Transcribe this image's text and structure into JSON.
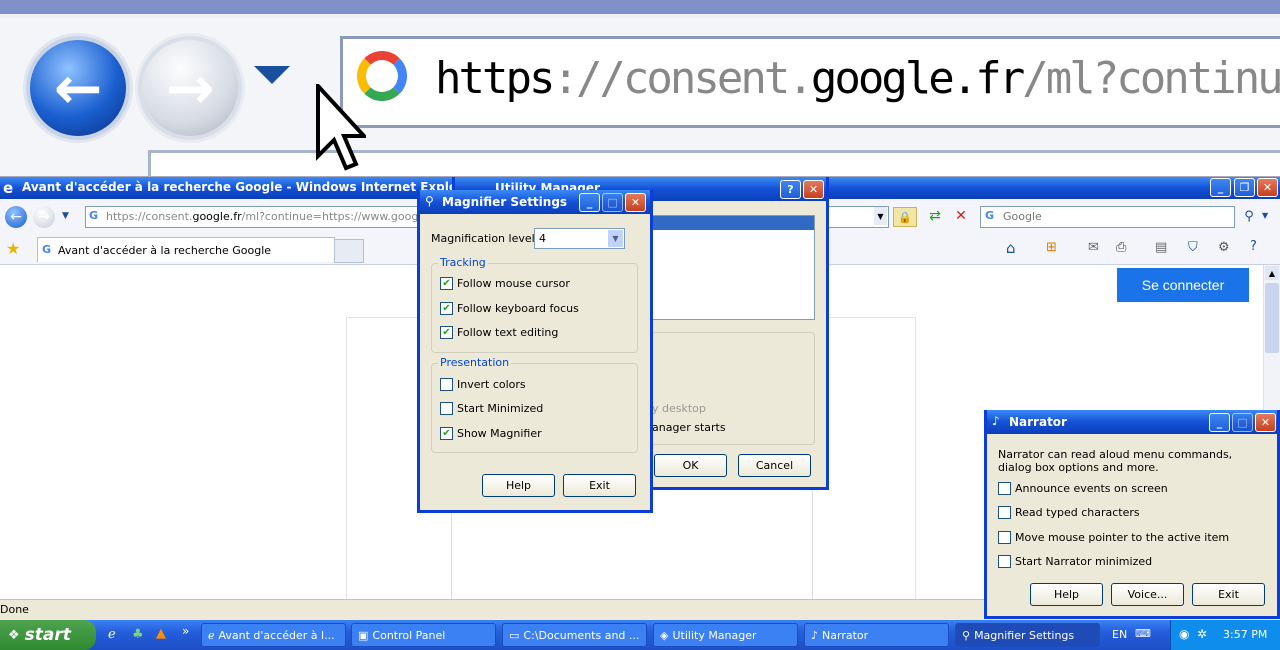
{
  "magnifier_pane": {
    "url_host_prefix": "https",
    "url_sep": "://consent.",
    "url_domain": "google.fr",
    "url_rest": "/ml?continue=http"
  },
  "ie": {
    "title": "Avant d'accéder à la recherche Google - Windows Internet Explorer",
    "address_prefix": "https://consent.",
    "address_domain": "google.fr",
    "address_rest": "/ml?continue=https://www.google.fr/?",
    "search_placeholder": "Google",
    "tab_label": "Avant d'accéder à la recherche Google",
    "sign_in": "Se connecter",
    "status": "Done"
  },
  "utility_manager": {
    "title": "Utility Manager",
    "ok": "OK",
    "cancel": "Cancel",
    "option_partial_1": "y desktop",
    "option_partial_2": "anager starts"
  },
  "magnifier": {
    "title": "Magnifier Settings",
    "level_label": "Magnification level:",
    "level_value": "4",
    "tracking_label": "Tracking",
    "tracking": [
      {
        "label": "Follow mouse cursor",
        "checked": true
      },
      {
        "label": "Follow keyboard focus",
        "checked": true
      },
      {
        "label": "Follow text editing",
        "checked": true
      }
    ],
    "presentation_label": "Presentation",
    "presentation": [
      {
        "label": "Invert colors",
        "checked": false
      },
      {
        "label": "Start Minimized",
        "checked": false
      },
      {
        "label": "Show Magnifier",
        "checked": true
      }
    ],
    "help": "Help",
    "exit": "Exit"
  },
  "narrator": {
    "title": "Narrator",
    "description": "Narrator can read aloud menu commands, dialog box options and more.",
    "options": [
      {
        "label": "Announce events on screen",
        "checked": false
      },
      {
        "label": "Read typed characters",
        "checked": false
      },
      {
        "label": "Move mouse pointer to the active item",
        "checked": false
      },
      {
        "label": "Start Narrator minimized",
        "checked": false
      }
    ],
    "help": "Help",
    "voice": "Voice...",
    "exit": "Exit"
  },
  "taskbar": {
    "start": "start",
    "chevron": "»",
    "items": [
      {
        "label": "Avant d'accéder à l...",
        "icon": "ie-icon"
      },
      {
        "label": "Control Panel",
        "icon": "control-panel-icon"
      },
      {
        "label": "C:\\Documents and ...",
        "icon": "folder-icon"
      },
      {
        "label": "Utility Manager",
        "icon": "utility-manager-icon"
      },
      {
        "label": "Narrator",
        "icon": "narrator-icon"
      },
      {
        "label": "Magnifier Settings",
        "icon": "magnifier-icon"
      }
    ],
    "language": "EN",
    "clock": "3:57 PM"
  },
  "colors": {
    "xp_blue": "#1451d6",
    "start_green": "#3a9a3d",
    "google_blue": "#1a73e8"
  }
}
